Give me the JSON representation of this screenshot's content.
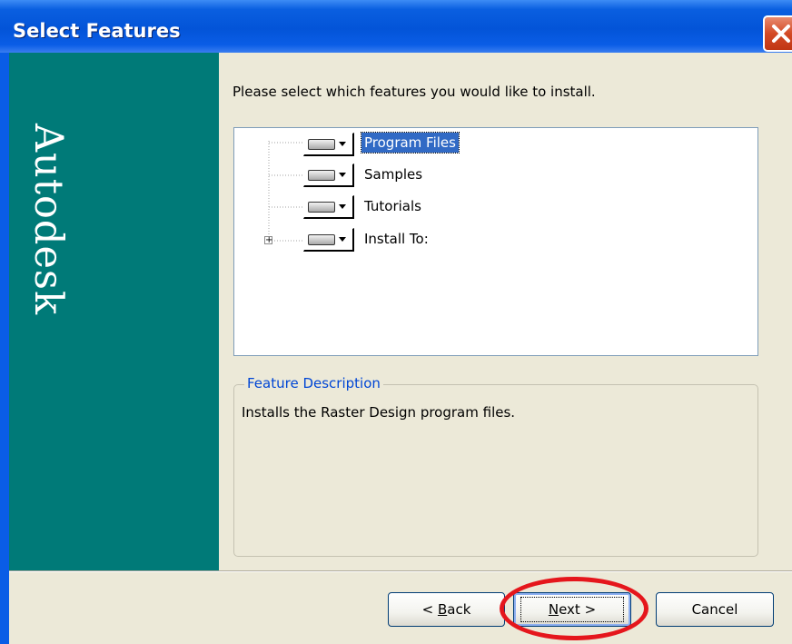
{
  "window": {
    "title": "Select Features",
    "brand": "Autodesk"
  },
  "main": {
    "prompt": "Please select which features you would like to install.",
    "features": [
      {
        "label": "Program Files",
        "selected": true,
        "icon": "drive-icon"
      },
      {
        "label": "Samples",
        "selected": false,
        "icon": "drive-icon"
      },
      {
        "label": "Tutorials",
        "selected": false,
        "icon": "drive-icon"
      },
      {
        "label": "Install To:",
        "selected": false,
        "icon": "drive-icon",
        "expandable": true
      }
    ],
    "description": {
      "legend": "Feature Description",
      "text": "Installs the Raster Design program files."
    }
  },
  "buttons": {
    "back": {
      "prefix": "< ",
      "mnemonic": "B",
      "suffix": "ack"
    },
    "next": {
      "mnemonic": "N",
      "suffix": "ext >"
    },
    "cancel": "Cancel"
  },
  "colors": {
    "side_panel": "#007a78",
    "selection": "#316ac5",
    "legend_text": "#0046d5",
    "annotation_circle": "#e5161c"
  }
}
